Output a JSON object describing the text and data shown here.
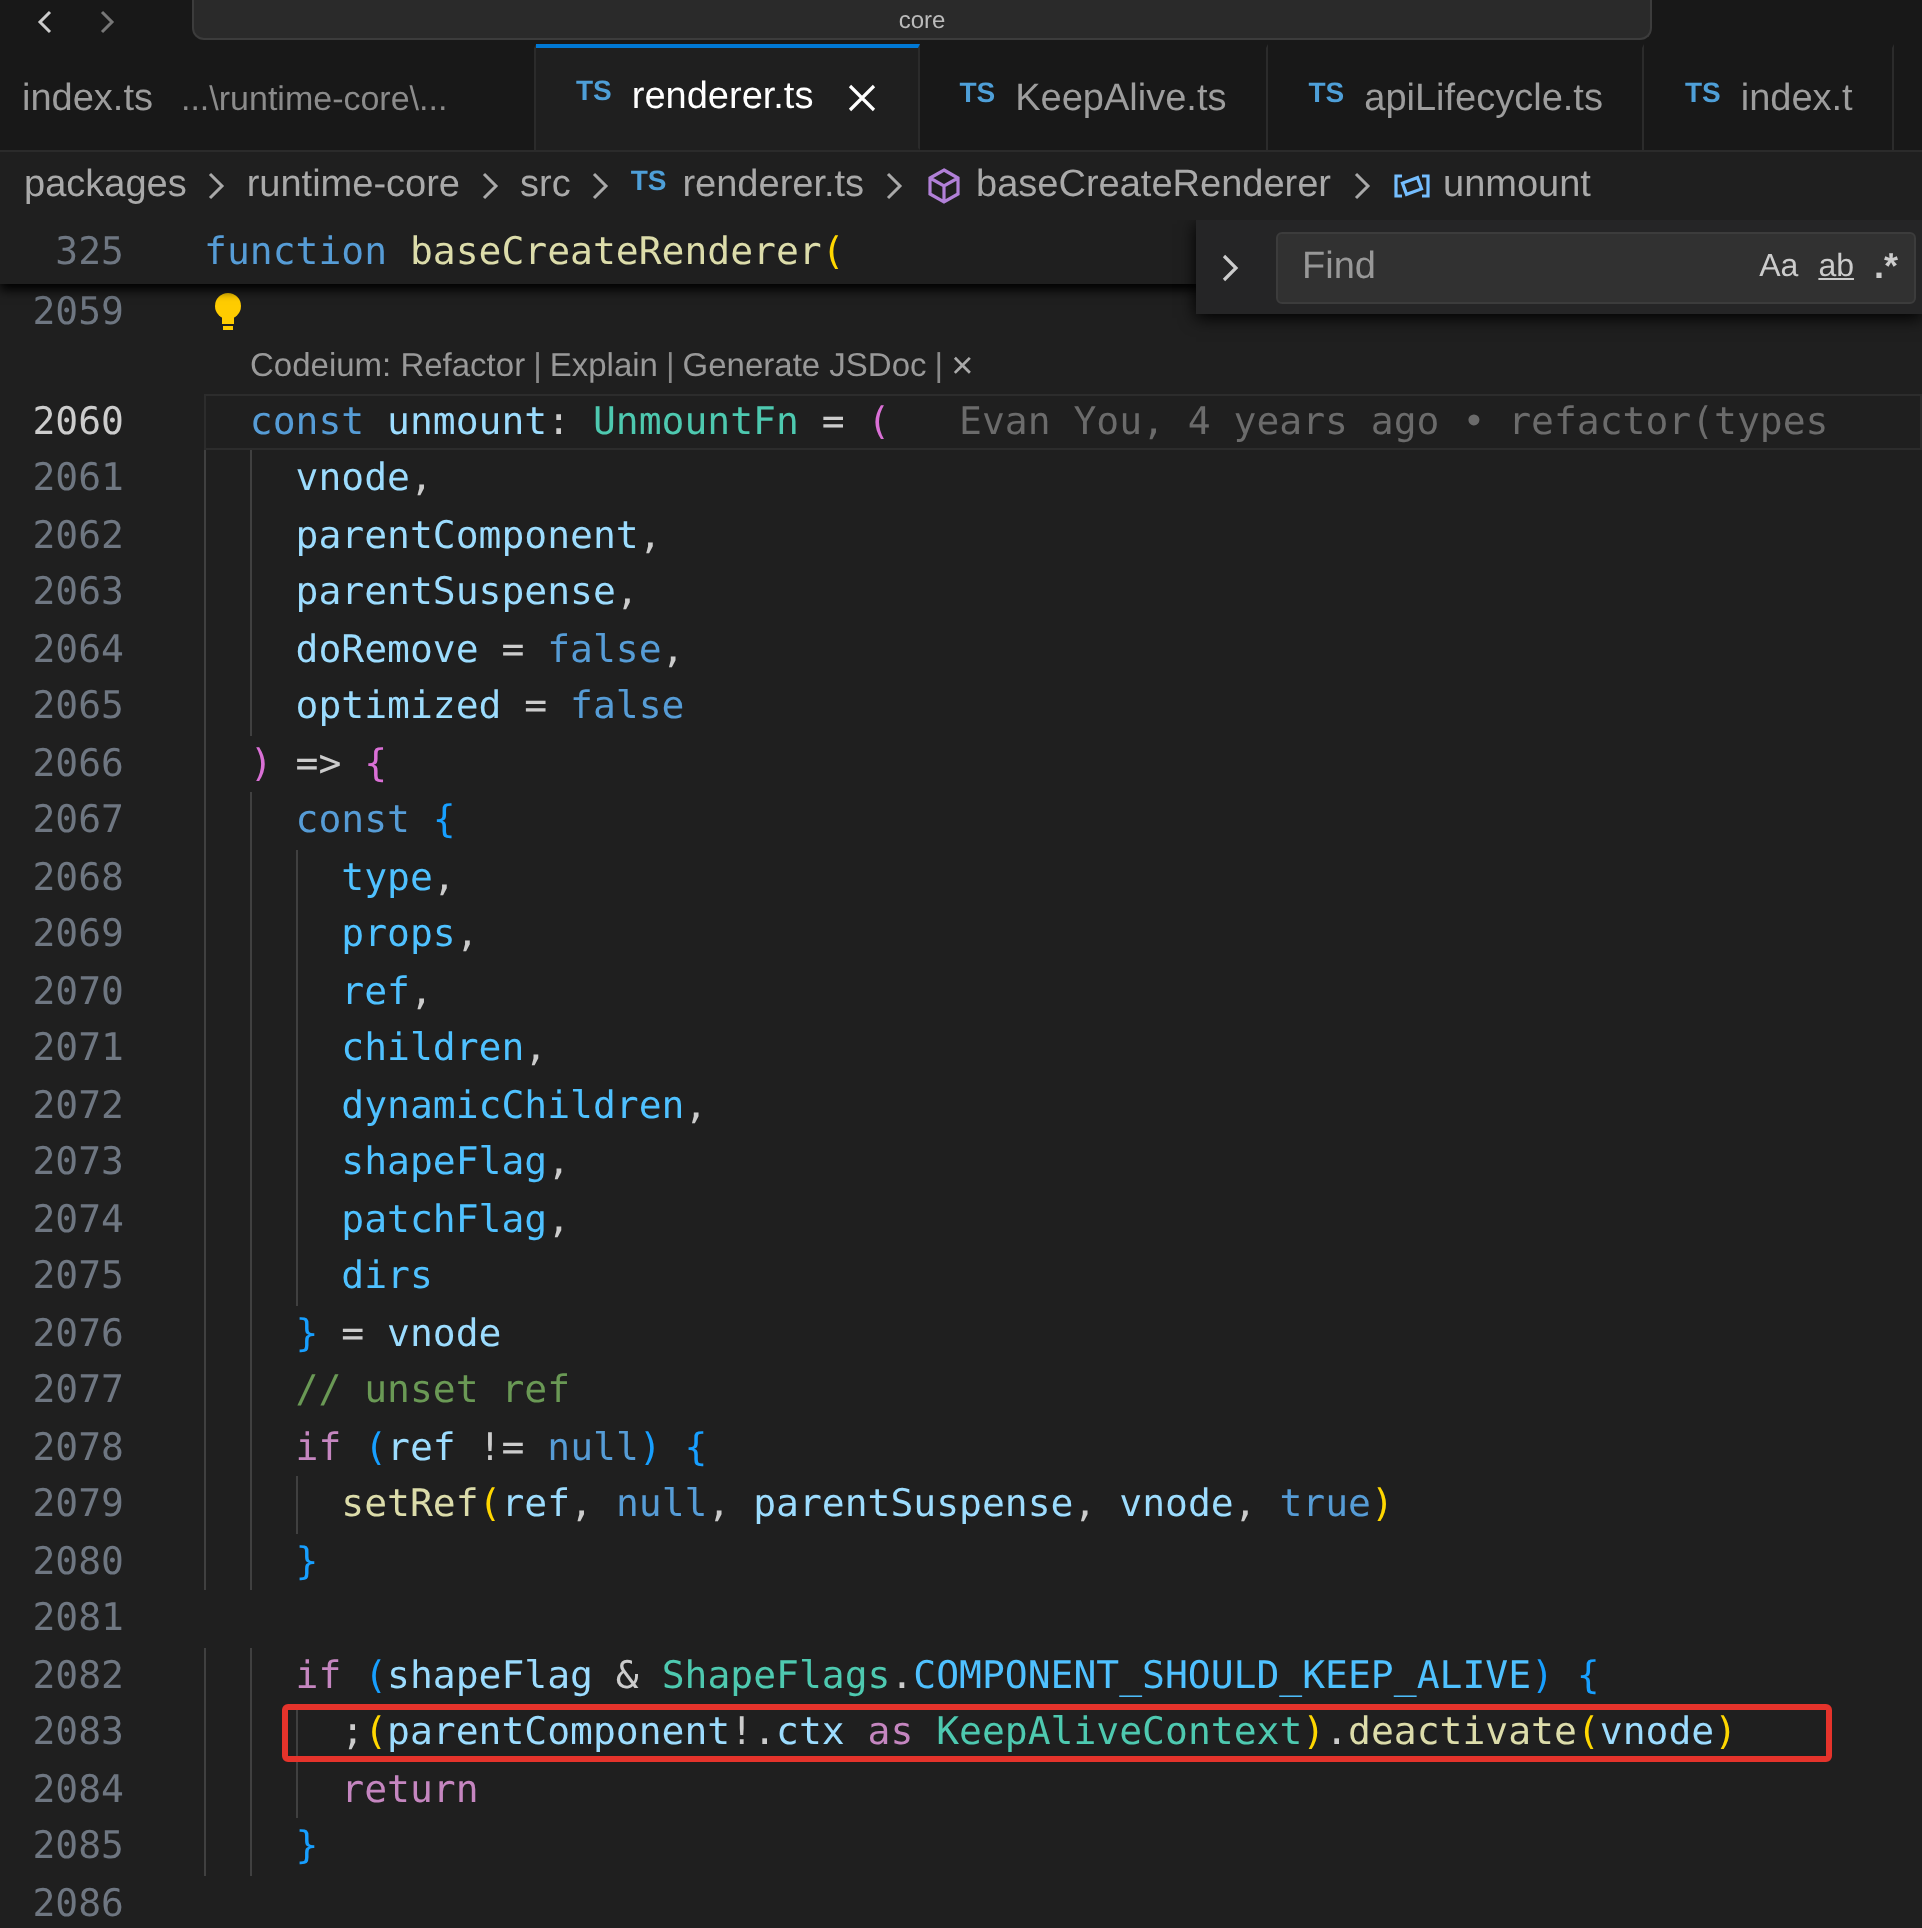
{
  "title_bar": {
    "search_text": "core"
  },
  "tabs": [
    {
      "label": "index.ts",
      "description": "...\\runtime-core\\...",
      "selected": false
    },
    {
      "icon_text": "TS",
      "label": "renderer.ts",
      "selected": true
    },
    {
      "icon_text": "TS",
      "label": "KeepAlive.ts",
      "selected": false
    },
    {
      "icon_text": "TS",
      "label": "apiLifecycle.ts",
      "selected": false
    },
    {
      "icon_text": "TS",
      "label": "index.t",
      "selected": false
    }
  ],
  "breadcrumb": [
    {
      "kind": "folder",
      "label": "packages"
    },
    {
      "kind": "folder",
      "label": "runtime-core"
    },
    {
      "kind": "folder",
      "label": "src"
    },
    {
      "kind": "file",
      "icon_text": "TS",
      "label": "renderer.ts"
    },
    {
      "kind": "class",
      "label": "baseCreateRenderer"
    },
    {
      "kind": "variable",
      "label": "unmount"
    }
  ],
  "editor": {
    "sticky_line": {
      "number": "325",
      "tokens": [
        {
          "kind": "k",
          "text": "function "
        },
        {
          "kind": "f",
          "text": "baseCreateRenderer"
        },
        {
          "kind": "b1",
          "text": "("
        }
      ]
    },
    "lightbulb_line": {
      "number": "2059",
      "lightbulb": true
    },
    "codelens": [
      {
        "kind": "link",
        "text": "Codeium: Refactor"
      },
      {
        "kind": "separator",
        "text": "|"
      },
      {
        "kind": "link",
        "text": "Explain"
      },
      {
        "kind": "separator",
        "text": "|"
      },
      {
        "kind": "link",
        "text": "Generate JSDoc"
      },
      {
        "kind": "separator",
        "text": "|"
      },
      {
        "kind": "close",
        "text": "×"
      }
    ],
    "lines": [
      {
        "number": "2060",
        "active": true,
        "highlighted": false,
        "tokens": [
          {
            "kind": "k",
            "text": "  const "
          },
          {
            "kind": "v",
            "text": "unmount"
          },
          {
            "kind": "p",
            "text": ": "
          },
          {
            "kind": "t",
            "text": "UnmountFn"
          },
          {
            "kind": "p",
            "text": " = "
          },
          {
            "kind": "b2",
            "text": "("
          }
        ],
        "blame": "Evan You, 4 years ago • refactor(types"
      },
      {
        "number": "2061",
        "active": false,
        "highlighted": false,
        "tokens": [
          {
            "kind": "v",
            "text": "    vnode"
          },
          {
            "kind": "p",
            "text": ","
          }
        ]
      },
      {
        "number": "2062",
        "active": false,
        "highlighted": false,
        "tokens": [
          {
            "kind": "v",
            "text": "    parentComponent"
          },
          {
            "kind": "p",
            "text": ","
          }
        ]
      },
      {
        "number": "2063",
        "active": false,
        "highlighted": false,
        "tokens": [
          {
            "kind": "v",
            "text": "    parentSuspense"
          },
          {
            "kind": "p",
            "text": ","
          }
        ]
      },
      {
        "number": "2064",
        "active": false,
        "highlighted": false,
        "tokens": [
          {
            "kind": "v",
            "text": "    doRemove"
          },
          {
            "kind": "p",
            "text": " = "
          },
          {
            "kind": "k",
            "text": "false"
          },
          {
            "kind": "p",
            "text": ","
          }
        ]
      },
      {
        "number": "2065",
        "active": false,
        "highlighted": false,
        "tokens": [
          {
            "kind": "v",
            "text": "    optimized"
          },
          {
            "kind": "p",
            "text": " = "
          },
          {
            "kind": "k",
            "text": "false"
          }
        ]
      },
      {
        "number": "2066",
        "active": false,
        "highlighted": false,
        "tokens": [
          {
            "kind": "b2",
            "text": "  )"
          },
          {
            "kind": "p",
            "text": " => "
          },
          {
            "kind": "b2",
            "text": "{"
          }
        ]
      },
      {
        "number": "2067",
        "active": false,
        "highlighted": false,
        "tokens": [
          {
            "kind": "k",
            "text": "    const "
          },
          {
            "kind": "b3",
            "text": "{"
          }
        ]
      },
      {
        "number": "2068",
        "active": false,
        "highlighted": false,
        "tokens": [
          {
            "kind": "c2",
            "text": "      type"
          },
          {
            "kind": "p",
            "text": ","
          }
        ]
      },
      {
        "number": "2069",
        "active": false,
        "highlighted": false,
        "tokens": [
          {
            "kind": "c2",
            "text": "      props"
          },
          {
            "kind": "p",
            "text": ","
          }
        ]
      },
      {
        "number": "2070",
        "active": false,
        "highlighted": false,
        "tokens": [
          {
            "kind": "c2",
            "text": "      ref"
          },
          {
            "kind": "p",
            "text": ","
          }
        ]
      },
      {
        "number": "2071",
        "active": false,
        "highlighted": false,
        "tokens": [
          {
            "kind": "c2",
            "text": "      children"
          },
          {
            "kind": "p",
            "text": ","
          }
        ]
      },
      {
        "number": "2072",
        "active": false,
        "highlighted": false,
        "tokens": [
          {
            "kind": "c2",
            "text": "      dynamicChildren"
          },
          {
            "kind": "p",
            "text": ","
          }
        ]
      },
      {
        "number": "2073",
        "active": false,
        "highlighted": false,
        "tokens": [
          {
            "kind": "c2",
            "text": "      shapeFlag"
          },
          {
            "kind": "p",
            "text": ","
          }
        ]
      },
      {
        "number": "2074",
        "active": false,
        "highlighted": false,
        "tokens": [
          {
            "kind": "c2",
            "text": "      patchFlag"
          },
          {
            "kind": "p",
            "text": ","
          }
        ]
      },
      {
        "number": "2075",
        "active": false,
        "highlighted": false,
        "tokens": [
          {
            "kind": "c2",
            "text": "      dirs"
          }
        ]
      },
      {
        "number": "2076",
        "active": false,
        "highlighted": false,
        "tokens": [
          {
            "kind": "b3",
            "text": "    }"
          },
          {
            "kind": "p",
            "text": " = "
          },
          {
            "kind": "v",
            "text": "vnode"
          }
        ]
      },
      {
        "number": "2077",
        "active": false,
        "highlighted": false,
        "tokens": [
          {
            "kind": "m",
            "text": "    // unset ref"
          }
        ]
      },
      {
        "number": "2078",
        "active": false,
        "highlighted": false,
        "tokens": [
          {
            "kind": "c",
            "text": "    if "
          },
          {
            "kind": "b3",
            "text": "("
          },
          {
            "kind": "v",
            "text": "ref"
          },
          {
            "kind": "p",
            "text": " != "
          },
          {
            "kind": "k",
            "text": "null"
          },
          {
            "kind": "b3",
            "text": ") {"
          }
        ]
      },
      {
        "number": "2079",
        "active": false,
        "highlighted": false,
        "tokens": [
          {
            "kind": "f",
            "text": "      setRef"
          },
          {
            "kind": "b1",
            "text": "("
          },
          {
            "kind": "v",
            "text": "ref"
          },
          {
            "kind": "p",
            "text": ", "
          },
          {
            "kind": "k",
            "text": "null"
          },
          {
            "kind": "p",
            "text": ", "
          },
          {
            "kind": "v",
            "text": "parentSuspense"
          },
          {
            "kind": "p",
            "text": ", "
          },
          {
            "kind": "v",
            "text": "vnode"
          },
          {
            "kind": "p",
            "text": ", "
          },
          {
            "kind": "k",
            "text": "true"
          },
          {
            "kind": "b1",
            "text": ")"
          }
        ]
      },
      {
        "number": "2080",
        "active": false,
        "highlighted": false,
        "tokens": [
          {
            "kind": "b3",
            "text": "    }"
          }
        ]
      },
      {
        "number": "2081",
        "active": false,
        "highlighted": false
      },
      {
        "number": "2082",
        "active": false,
        "highlighted": false,
        "tokens": [
          {
            "kind": "c",
            "text": "    if "
          },
          {
            "kind": "b3",
            "text": "("
          },
          {
            "kind": "v",
            "text": "shapeFlag"
          },
          {
            "kind": "p",
            "text": " & "
          },
          {
            "kind": "t",
            "text": "ShapeFlags"
          },
          {
            "kind": "p",
            "text": "."
          },
          {
            "kind": "c2",
            "text": "COMPONENT_SHOULD_KEEP_ALIVE"
          },
          {
            "kind": "b3",
            "text": ") {"
          }
        ]
      },
      {
        "number": "2083",
        "active": false,
        "highlighted": true,
        "tokens": [
          {
            "kind": "p",
            "text": "      ;"
          },
          {
            "kind": "b1",
            "text": "("
          },
          {
            "kind": "v",
            "text": "parentComponent"
          },
          {
            "kind": "p",
            "text": "!."
          },
          {
            "kind": "v",
            "text": "ctx "
          },
          {
            "kind": "c",
            "text": "as "
          },
          {
            "kind": "t",
            "text": "KeepAliveContext"
          },
          {
            "kind": "b1",
            "text": ")"
          },
          {
            "kind": "p",
            "text": "."
          },
          {
            "kind": "f",
            "text": "deactivate"
          },
          {
            "kind": "b1",
            "text": "("
          },
          {
            "kind": "v",
            "text": "vnode"
          },
          {
            "kind": "b1",
            "text": ")"
          }
        ]
      },
      {
        "number": "2084",
        "active": false,
        "highlighted": false,
        "tokens": [
          {
            "kind": "c",
            "text": "      return"
          }
        ]
      },
      {
        "number": "2085",
        "active": false,
        "highlighted": false,
        "tokens": [
          {
            "kind": "b3",
            "text": "    }"
          }
        ]
      },
      {
        "number": "2086",
        "active": false,
        "highlighted": false
      }
    ]
  },
  "find_widget": {
    "placeholder": "Find",
    "options": [
      {
        "kind": "case",
        "text": "Aa"
      },
      {
        "kind": "word",
        "text": "ab"
      },
      {
        "kind": "regex",
        "text": ".*"
      }
    ]
  }
}
